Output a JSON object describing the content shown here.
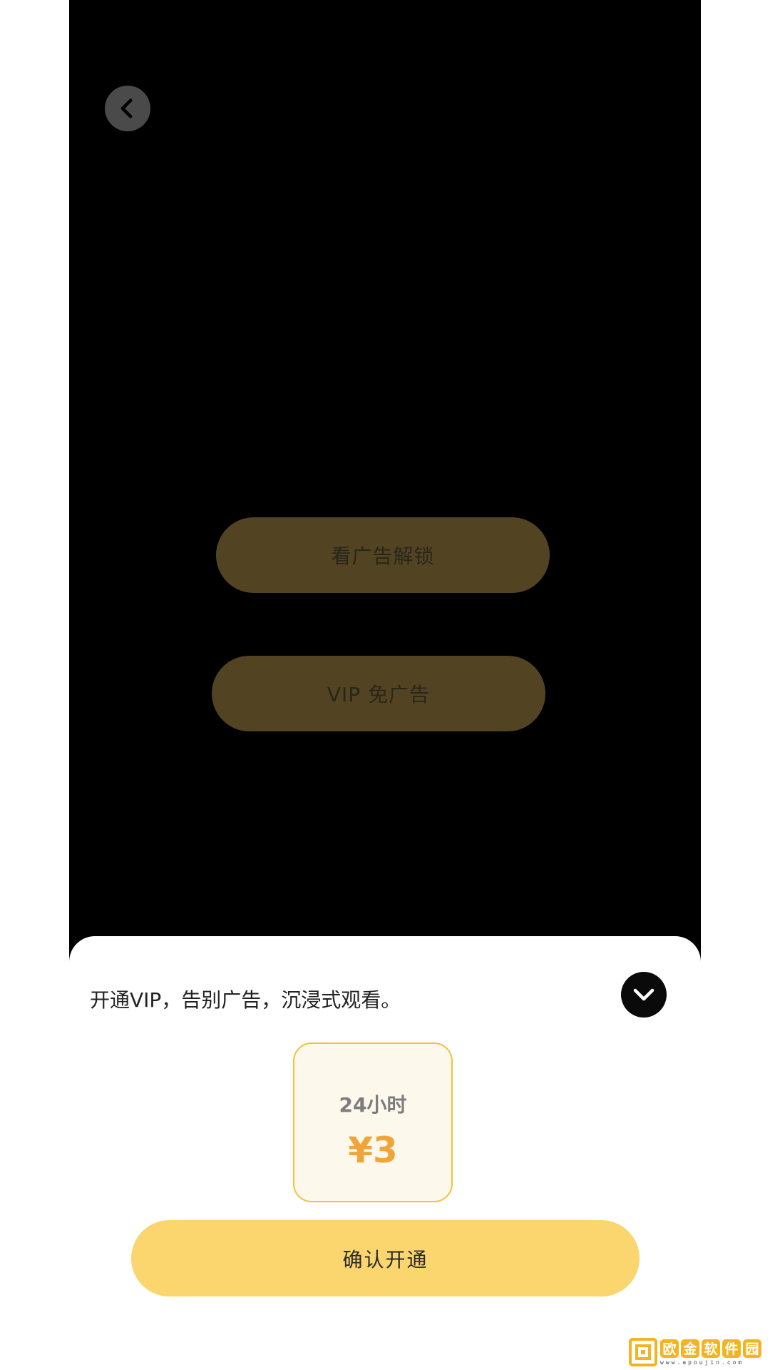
{
  "player": {
    "back_icon": "chevron-left-icon",
    "buttons": {
      "watch_ad_unlock": "看广告解锁",
      "vip_no_ads": "VIP 免广告"
    }
  },
  "vip_sheet": {
    "promo_text": "开通VIP，告别广告，沉浸式观看。",
    "collapse_icon": "chevron-down-icon",
    "plan": {
      "duration": "24小时",
      "price": "¥3"
    },
    "confirm_label": "确认开通"
  },
  "watermark": {
    "chars": [
      "欧",
      "金",
      "软",
      "件",
      "园"
    ],
    "url": "www.apoujin.com"
  },
  "colors": {
    "player_bg": "#000000",
    "dimmed_button": "#524423",
    "accent_yellow": "#fbd56e",
    "card_border": "#f3c13d",
    "price_orange": "#f0a43a"
  }
}
